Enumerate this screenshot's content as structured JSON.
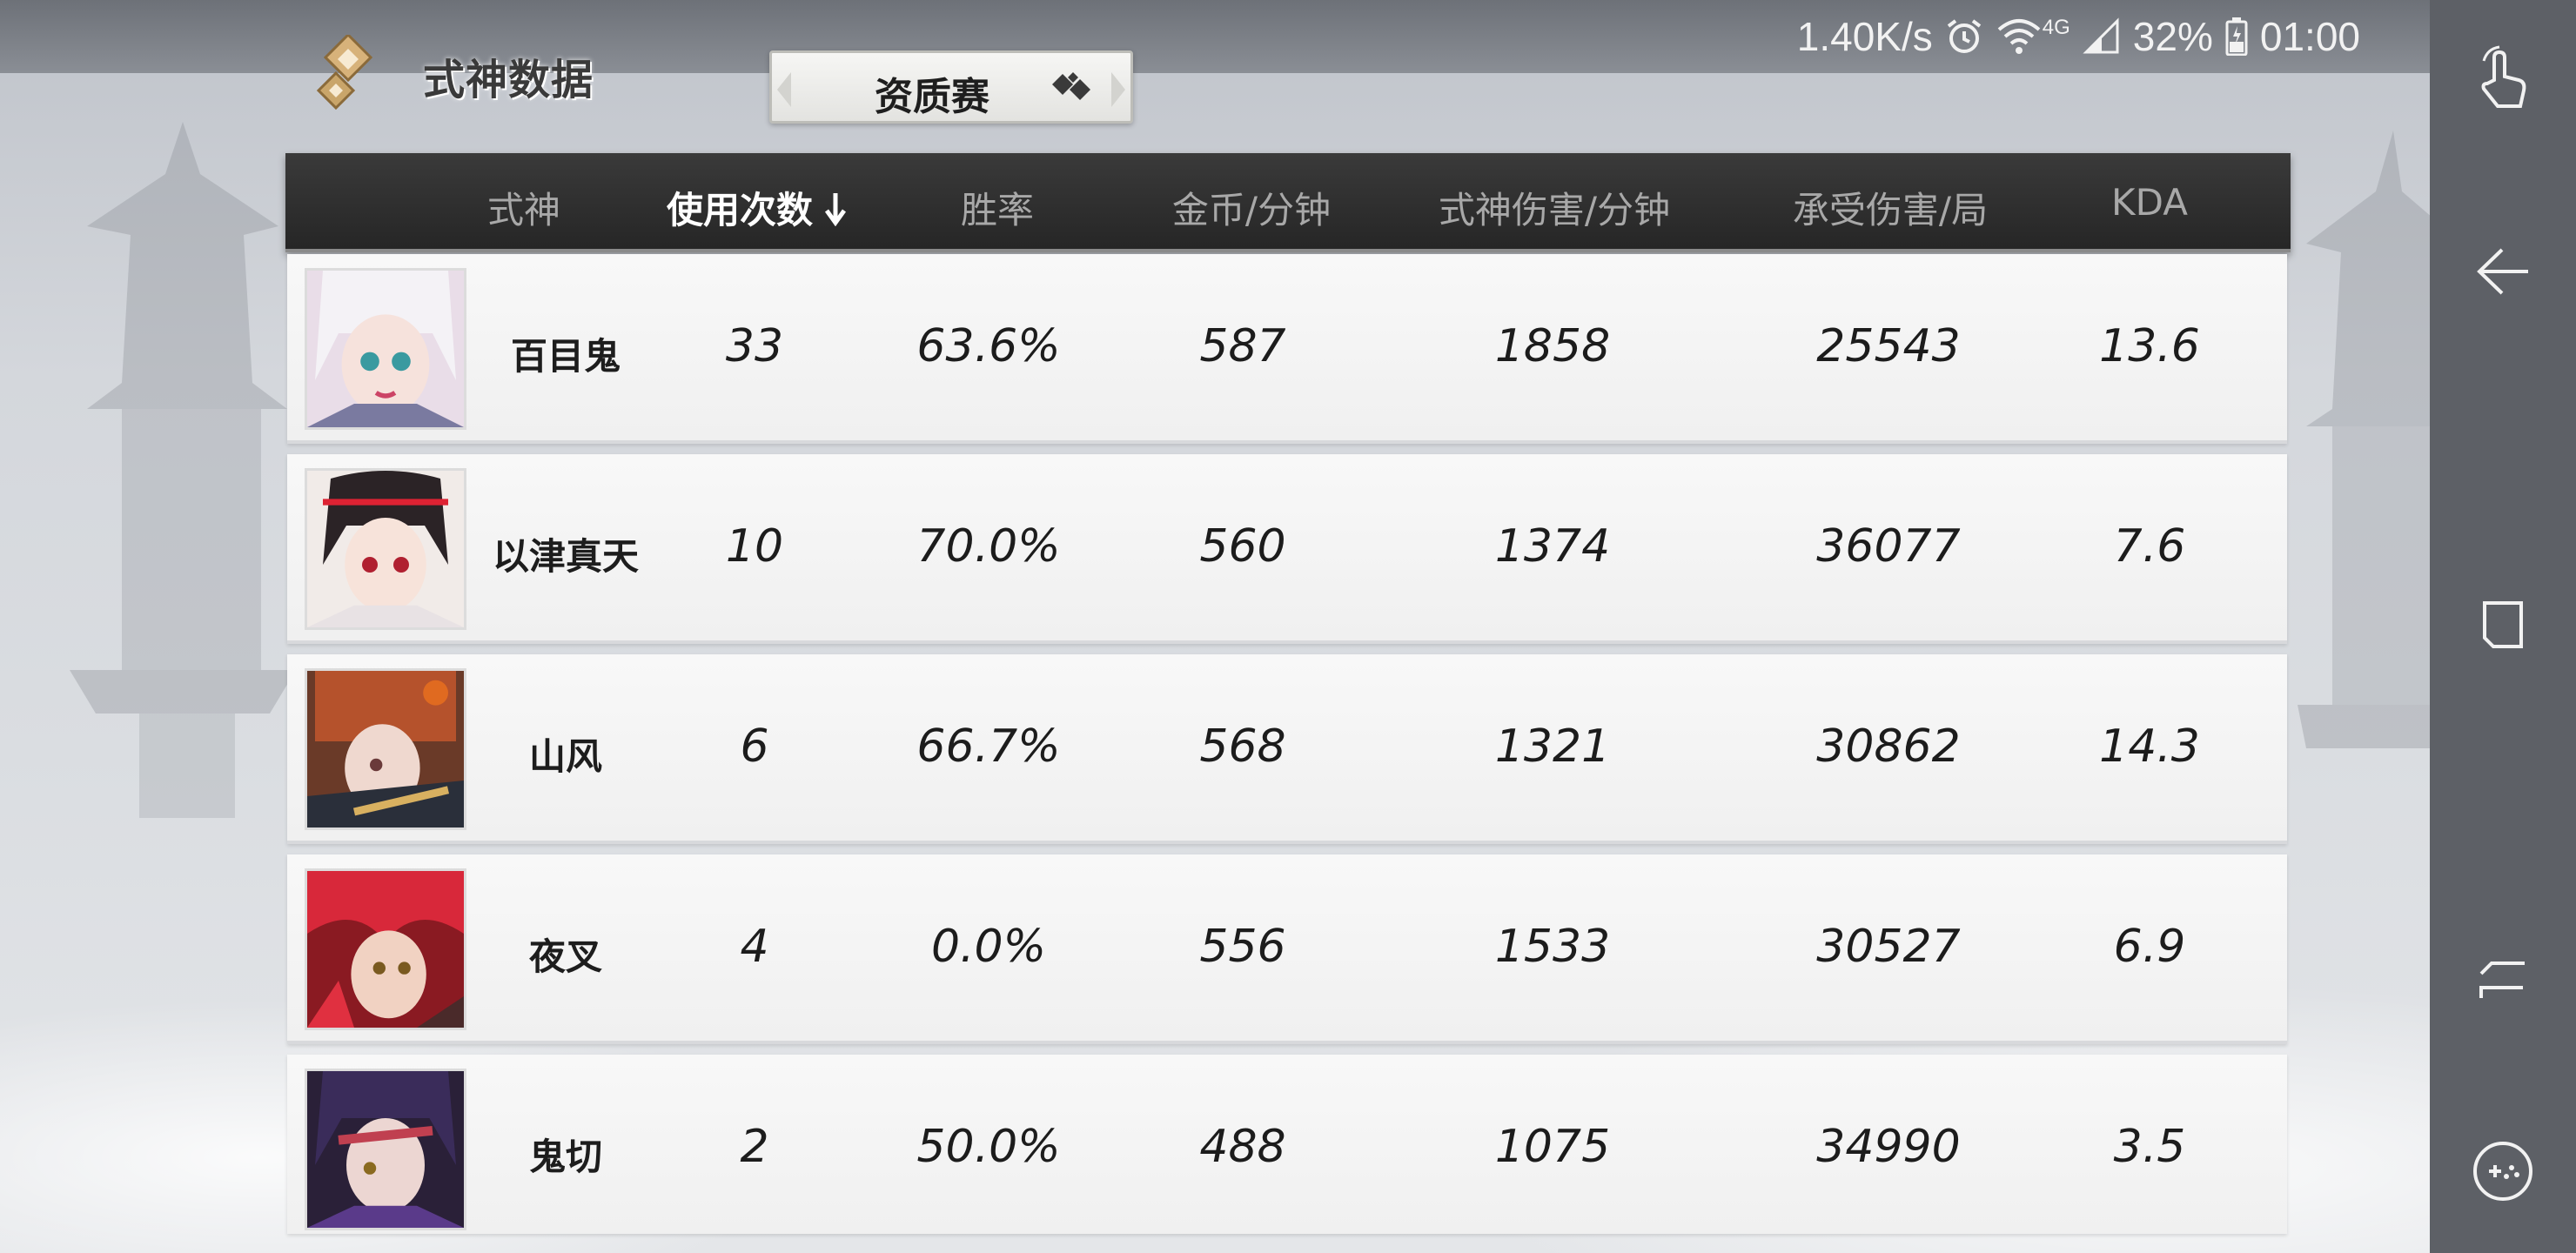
{
  "status_bar": {
    "net_speed": "1.40K/s",
    "network_type": "4G",
    "battery": "32%",
    "time": "01:00",
    "icons": [
      "alarm-icon",
      "wifi-icon",
      "signal-icon",
      "battery-icon"
    ]
  },
  "header": {
    "title": "式神数据",
    "mode_tab": "资质赛"
  },
  "table": {
    "columns": [
      "式神",
      "使用次数",
      "胜率",
      "金币/分钟",
      "式神伤害/分钟",
      "承受伤害/局",
      "KDA"
    ],
    "sorted_column": "使用次数",
    "sort_direction": "desc",
    "rows": [
      {
        "name": "百目鬼",
        "uses": "33",
        "win_rate": "63.6%",
        "gold_per_min": "587",
        "damage_per_min": "1858",
        "damage_taken": "25543",
        "kda": "13.6"
      },
      {
        "name": "以津真天",
        "uses": "10",
        "win_rate": "70.0%",
        "gold_per_min": "560",
        "damage_per_min": "1374",
        "damage_taken": "36077",
        "kda": "7.6"
      },
      {
        "name": "山风",
        "uses": "6",
        "win_rate": "66.7%",
        "gold_per_min": "568",
        "damage_per_min": "1321",
        "damage_taken": "30862",
        "kda": "14.3"
      },
      {
        "name": "夜叉",
        "uses": "4",
        "win_rate": "0.0%",
        "gold_per_min": "556",
        "damage_per_min": "1533",
        "damage_taken": "30527",
        "kda": "6.9"
      },
      {
        "name": "鬼切",
        "uses": "2",
        "win_rate": "50.0%",
        "gold_per_min": "488",
        "damage_per_min": "1075",
        "damage_taken": "34990",
        "kda": "3.5"
      }
    ]
  },
  "nav_bar": {
    "buttons": [
      "touch-gesture-icon",
      "back-icon",
      "recent-apps-icon",
      "home-icon",
      "game-controller-icon"
    ]
  },
  "colors": {
    "header_bg": "#2e2e2e",
    "row_bg": "#f5f5f5",
    "active_header_text": "#ffffff",
    "inactive_header_text": "#a8a8a8",
    "nav_bar_bg": "#5d6066"
  }
}
